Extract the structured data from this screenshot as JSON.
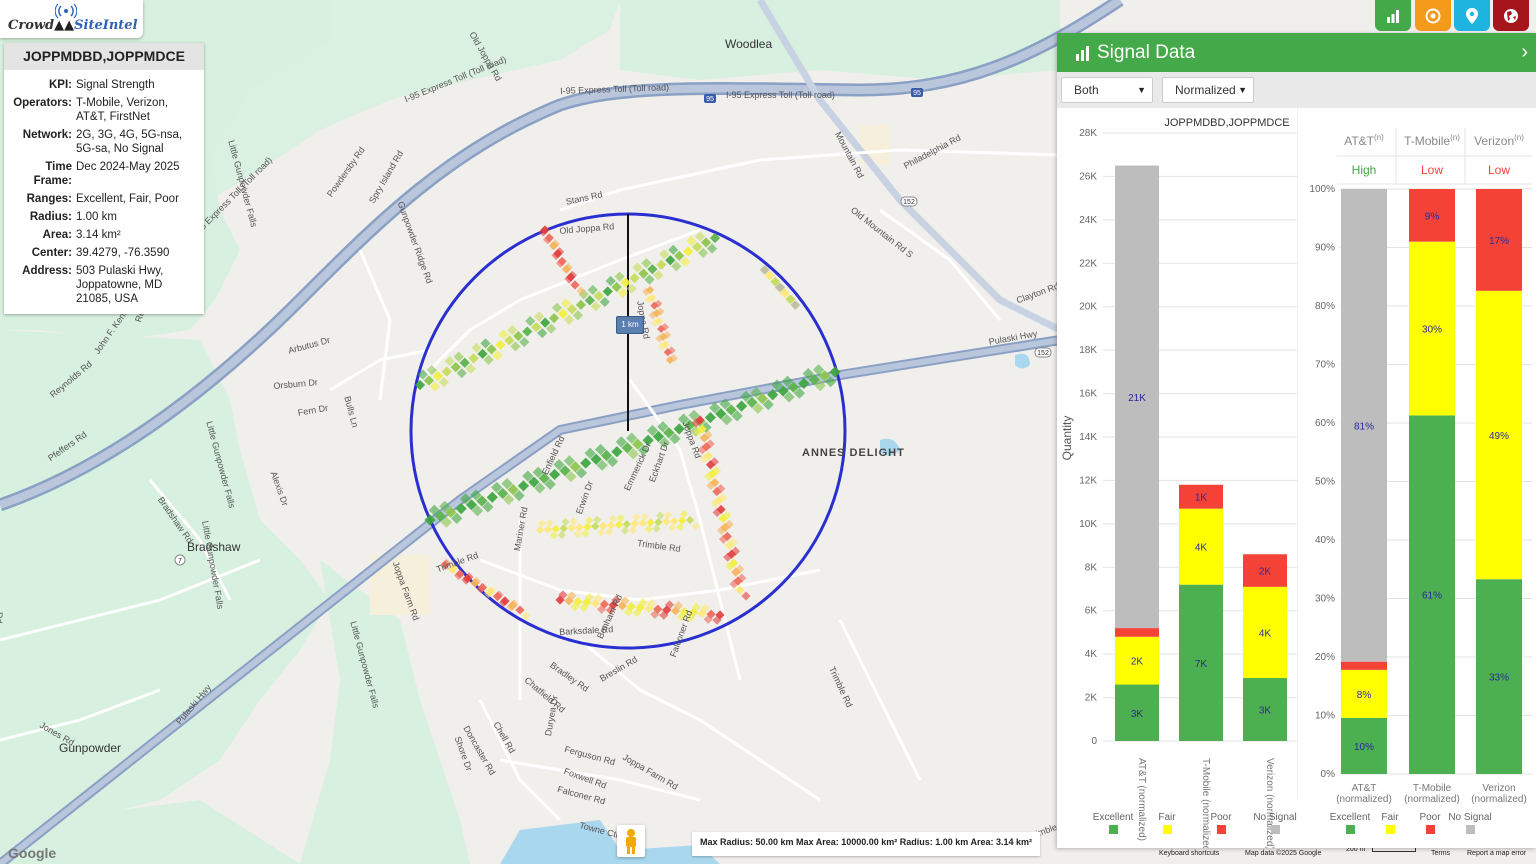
{
  "app": {
    "logo_word1": "Crowd",
    "logo_word2": "SiteIntel"
  },
  "info": {
    "title": "JOPPMDBD,JOPPMDCE",
    "rows": [
      {
        "k": "KPI:",
        "v": "Signal Strength"
      },
      {
        "k": "Operators:",
        "v": "T-Mobile, Verizon, AT&T, FirstNet"
      },
      {
        "k": "Network:",
        "v": "2G, 3G, 4G, 5G-nsa, 5G-sa, No Signal"
      },
      {
        "k": "Time Frame:",
        "v": "Dec 2024-May 2025"
      },
      {
        "k": "Ranges:",
        "v": "Excellent, Fair, Poor"
      },
      {
        "k": "Radius:",
        "v": "1.00 km"
      },
      {
        "k": "Area:",
        "v": "3.14 km²"
      },
      {
        "k": "Center:",
        "v": "39.4279, -76.3590"
      },
      {
        "k": "Address:",
        "v": "503 Pulaski Hwy, Joppatowne, MD 21085, USA"
      }
    ]
  },
  "map": {
    "places": [
      {
        "name": "Woodlea"
      },
      {
        "name": "Bradshaw"
      },
      {
        "name": "Gunpowder"
      },
      {
        "name": "ANNES DELIGHT"
      }
    ],
    "roads": [
      "I-95 Express Toll (Toll road)",
      "I-95 Express Toll (Toll road)",
      "I-95 Express Toll (Toll road)",
      "Old Joppa Rd",
      "Stans Rd",
      "Philadelphia Rd",
      "Mountain Rd",
      "Old Mountain Rd S",
      "Clayton Rd",
      "Pulaski Hwy",
      "Powdersby Rd",
      "Spry Island Rd",
      "Gunpowder Ridge Rd",
      "Arbutus Dr",
      "Orsburn Dr",
      "Fern Dr",
      "Bulls Ln",
      "John F. Kennedy Memorial Hwy",
      "Reynolds Rd",
      "Bradshaw Rd",
      "Pfeffers Rd",
      "Alexis Dr",
      "Enfield Rd",
      "Erwin Dr",
      "Emmerick Dr",
      "Eckhart Dr",
      "Trimble Rd",
      "Joppa Farm Rd",
      "Mariner Rd",
      "Barksdale Rd",
      "Bradley Rd",
      "Bonham Rd",
      "Breslin Rd",
      "Falconer Rd",
      "Chatfield Rd",
      "Doncaster Rd",
      "Chell Rd",
      "Shore Dr",
      "Duryea Dr",
      "Ferguson Rd",
      "Foxwell Rd",
      "Falconer Rd",
      "Joppa Farm Rd",
      "Towne Ctr",
      "Jones Rd",
      "Little Gunpowder Falls",
      "Little Gunpowder Falls",
      "Little Gunpowder Falls",
      "Pulaski Hwy",
      "Joppa Rd",
      "Joppa Rd",
      "Trimble Rd",
      "Trimble Rd",
      "Old Joppa Rd",
      "Rd",
      "Reynolds",
      "Little Gunpowder Falls",
      "I-95 Express Toll (Toll road)",
      "Trimble",
      "Hwy",
      "Rd"
    ],
    "route_badges": [
      "95",
      "95",
      "152",
      "152",
      "7"
    ],
    "scale_label": "1 km",
    "google_label": "Google",
    "max_info": "Max Radius: 50.00 km Max Area: 10000.00 km² Radius: 1.00 km Area: 3.14 km²",
    "keyboard_shortcuts": "Keyboard shortcuts",
    "map_data": "Map data ©2025 Google",
    "scale_text": "200 m",
    "terms": "Terms",
    "report": "Report a map error"
  },
  "panel": {
    "title": "Signal Data",
    "select_mode": "Both",
    "select_norm": "Normalized",
    "chart_title": "JOPPMDBD,JOPPMDCE",
    "colors": {
      "excellent": "#4caf50",
      "fair": "#ffff00",
      "poor": "#f44336",
      "no_signal": "#bdbdbd",
      "accent": "#44a948"
    }
  },
  "chart_data": [
    {
      "type": "bar",
      "stacked": true,
      "title": "JOPPMDBD,JOPPMDCE",
      "ylabel": "Quantity",
      "ylim": [
        0,
        28000
      ],
      "yticks": [
        "0",
        "2K",
        "4K",
        "6K",
        "8K",
        "10K",
        "12K",
        "14K",
        "16K",
        "18K",
        "20K",
        "22K",
        "24K",
        "26K",
        "28K"
      ],
      "categories": [
        "AT&T (normalized)",
        "T-Mobile (normalized)",
        "Verizon (normalized)"
      ],
      "series": [
        {
          "name": "Excellent",
          "values": [
            2600,
            7200,
            2900
          ],
          "labels": [
            "3K",
            "7K",
            "3K"
          ]
        },
        {
          "name": "Fair",
          "values": [
            2200,
            3500,
            4200
          ],
          "labels": [
            "2K",
            "4K",
            "4K"
          ]
        },
        {
          "name": "Poor",
          "values": [
            400,
            1100,
            1500
          ],
          "labels": [
            "",
            "1K",
            "2K"
          ]
        },
        {
          "name": "No Signal",
          "values": [
            21300,
            0,
            0
          ],
          "labels": [
            "21K",
            "",
            ""
          ]
        }
      ]
    },
    {
      "type": "bar",
      "stacked": true,
      "ylim": [
        0,
        100
      ],
      "yticks": [
        "0%",
        "10%",
        "20%",
        "30%",
        "40%",
        "50%",
        "60%",
        "70%",
        "80%",
        "90%",
        "100%"
      ],
      "categories": [
        "AT&T (normalized)",
        "T-Mobile (normalized)",
        "Verizon (normalized)"
      ],
      "headers": [
        {
          "name": "AT&T",
          "sup": "(n)",
          "rating": "High",
          "rating_color": "#44a948"
        },
        {
          "name": "T-Mobile",
          "sup": "(n)",
          "rating": "Low",
          "rating_color": "#f44336"
        },
        {
          "name": "Verizon",
          "sup": "(n)",
          "rating": "Low",
          "rating_color": "#f44336"
        }
      ],
      "series": [
        {
          "name": "Excellent",
          "values": [
            9.6,
            61.3,
            33.3
          ],
          "labels": [
            "10%",
            "61%",
            "33%"
          ]
        },
        {
          "name": "Fair",
          "values": [
            8.2,
            29.7,
            49.3
          ],
          "labels": [
            "8%",
            "30%",
            "49%"
          ]
        },
        {
          "name": "Poor",
          "values": [
            1.4,
            9.0,
            17.4
          ],
          "labels": [
            "",
            "9%",
            "17%"
          ]
        },
        {
          "name": "No Signal",
          "values": [
            80.8,
            0,
            0
          ],
          "labels": [
            "81%",
            "",
            ""
          ]
        }
      ]
    }
  ],
  "legend": [
    "Excellent",
    "Fair",
    "Poor",
    "No Signal"
  ]
}
